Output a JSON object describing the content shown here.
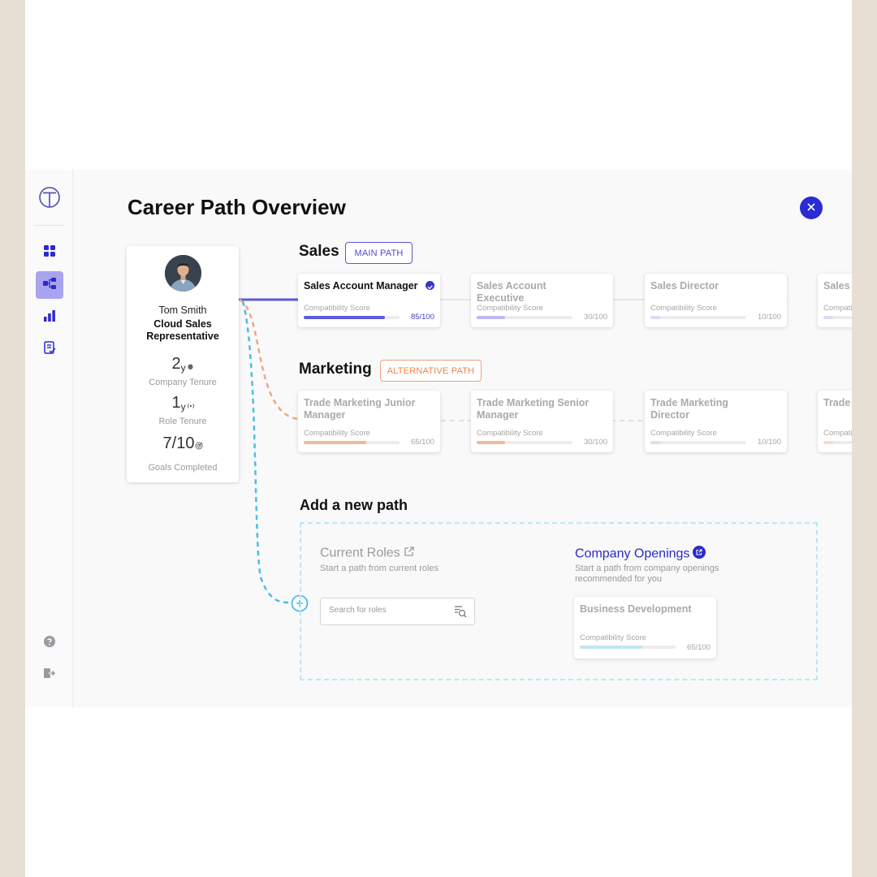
{
  "page": {
    "title": "Career Path Overview"
  },
  "sidebar": {
    "logo_icon": "logo-t-icon",
    "items": [
      {
        "name": "dashboard",
        "icon": "grid-icon",
        "active": false
      },
      {
        "name": "career-paths",
        "icon": "flow-icon",
        "active": true
      },
      {
        "name": "analytics",
        "icon": "bar-chart-icon",
        "active": false
      },
      {
        "name": "tasks",
        "icon": "checklist-icon",
        "active": false
      }
    ],
    "bottom": [
      {
        "name": "help",
        "icon": "help-icon"
      },
      {
        "name": "logout",
        "icon": "logout-icon"
      }
    ]
  },
  "profile": {
    "name": "Tom Smith",
    "role": "Cloud Sales Representative",
    "stats": [
      {
        "value": "2",
        "unit": "y",
        "label": "Company Tenure",
        "icon": "tenure-icon"
      },
      {
        "value": "1",
        "unit": "y",
        "label": "Role Tenure",
        "icon": "signal-icon"
      },
      {
        "value": "7/10",
        "unit": "",
        "label": "Goals Completed",
        "icon": "target-icon"
      }
    ]
  },
  "paths": {
    "sales": {
      "title": "Sales",
      "tag": "MAIN PATH",
      "color": "#5b5bdb",
      "cards": [
        {
          "title": "Sales Account Manager",
          "label": "Compatibility Score",
          "score": "85/100",
          "value": 85,
          "active": true,
          "bar_color": "#5b5bdb"
        },
        {
          "title": "Sales Account Executive",
          "label": "Compatibility Score",
          "score": "30/100",
          "value": 30,
          "active": false,
          "bar_color": "#bdb8f2"
        },
        {
          "title": "Sales Director",
          "label": "Compatibility Score",
          "score": "10/100",
          "value": 10,
          "active": false,
          "bar_color": "#dcdcf0"
        },
        {
          "title": "Sales",
          "label": "Compatibility Score",
          "score": "",
          "value": 10,
          "active": false,
          "bar_color": "#dcdcf0"
        }
      ]
    },
    "marketing": {
      "title": "Marketing",
      "tag": "ALTERNATIVE PATH",
      "color": "#f2a67d",
      "cards": [
        {
          "title": "Trade Marketing Junior Manager",
          "label": "Compatibility Score",
          "score": "65/100",
          "value": 65,
          "bar_color": "#f3b89a"
        },
        {
          "title": "Trade Marketing Senior Manager",
          "label": "Compatibility Score",
          "score": "30/100",
          "value": 30,
          "bar_color": "#f3b89a"
        },
        {
          "title": "Trade Marketing Director",
          "label": "Compatibility Score",
          "score": "10/100",
          "value": 10,
          "bar_color": "#f6dccc"
        },
        {
          "title": "Trade",
          "label": "Compatibility Score",
          "score": "",
          "value": 10,
          "bar_color": "#f6dccc"
        }
      ]
    }
  },
  "add_path": {
    "title": "Add a new path",
    "current_roles": {
      "title": "Current Roles",
      "desc": "Start a path from current roles",
      "search_placeholder": "Search for roles"
    },
    "company_openings": {
      "title": "Company Openings",
      "desc": "Start a path from company openings recommended for you",
      "card": {
        "title": "Business Development",
        "label": "Compatibility Score",
        "score": "65/100",
        "value": 65,
        "bar_color": "#bfe6ef"
      }
    }
  }
}
